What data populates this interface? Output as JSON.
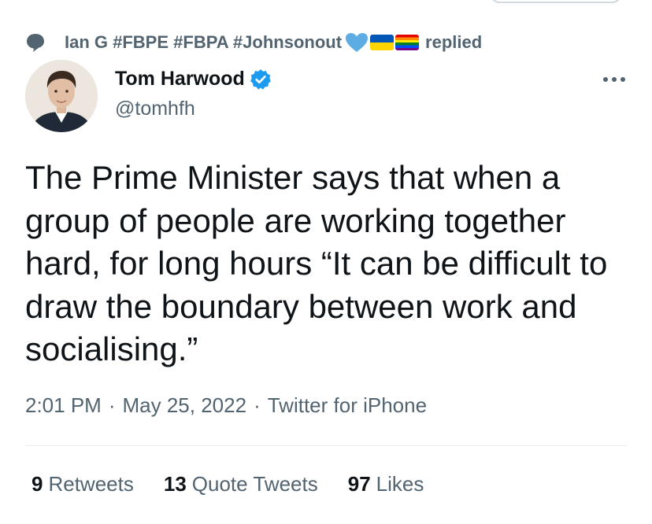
{
  "social_context": {
    "user": "Ian G #FBPE #FBPA #Johnsonout",
    "action": "replied"
  },
  "tweet": {
    "author_name": "Tom Harwood",
    "author_handle": "@tomhfh",
    "text": "The Prime Minister says that when a group of people are working together hard, for long hours “It can be difficult to draw the boundary between work and socialising.”",
    "time": "2:01 PM",
    "date": "May 25, 2022",
    "source": "Twitter for iPhone",
    "separator": "·"
  },
  "stats": {
    "retweets_count": "9",
    "retweets_label": "Retweets",
    "quote_tweets_count": "13",
    "quote_tweets_label": "Quote Tweets",
    "likes_count": "97",
    "likes_label": "Likes"
  },
  "colors": {
    "text_primary": "#0f1419",
    "text_secondary": "#536471",
    "verified_blue": "#1d9bf0",
    "heart_blue": "#5dade2",
    "divider": "#e6ecf0"
  },
  "icons": {
    "context": "speech-bubble-icon",
    "verified": "verified-badge-icon",
    "more": "more-options-icon",
    "emoji": [
      "blue-heart-icon",
      "ukraine-flag-icon",
      "rainbow-flag-icon"
    ]
  }
}
